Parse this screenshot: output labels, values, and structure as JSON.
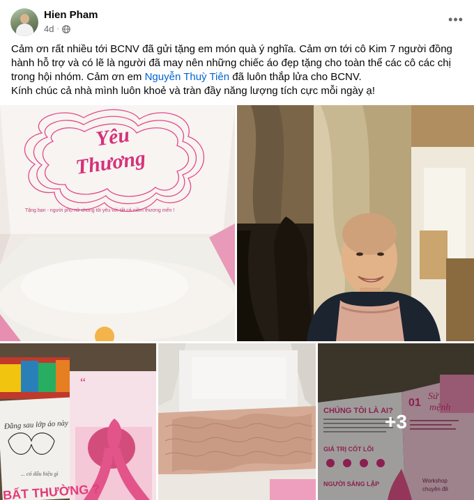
{
  "post": {
    "author": "Hien Pham",
    "time": "4d",
    "paragraphs": {
      "p1_before": "Cảm ơn rất nhiều tới BCNV đã gửi tặng em món quà ý nghĩa. Cảm ơn tới cô Kim 7 người đồng hành hỗ trợ và có lẽ là người đã may nên những chiếc áo đẹp tặng cho toàn thể các cô các chị trong hội nhóm. Cảm ơn em ",
      "mention": "Nguyễn Thuỳ Tiên",
      "p1_after": " đã luôn thắp lửa cho BCNV.",
      "p2": "Kính chúc cả nhà mình luôn khoẻ và tràn đầy năng lượng tích cực mỗi ngày ạ!"
    }
  },
  "photos": {
    "box_lettering": "Yêu Thương",
    "box_tagline": "Tặng bạn - người phụ nữ chúng tôi yêu với tất cả niềm thương mến !",
    "booklet_left_text": "Đằng sau lớp áo này",
    "booklet_left_sub": "... có dấu hiệu gì",
    "booklet_bottom_text": "BẤT THƯỜNG ?",
    "brochure_heading": "CHÚNG TÔI LÀ AI?",
    "brochure_values": "GIÁ TRỊ CỐT LÕI",
    "brochure_founder": "NGƯỜI SÁNG LẬP",
    "brochure_number": "01",
    "brochure_mission": "Sứ mệnh",
    "brochure_workshop": "Workshop chuyên đề",
    "more_count": "+3"
  },
  "icons": {
    "visibility": "globe-icon",
    "menu": "more-options-icon"
  },
  "colors": {
    "text": "#050505",
    "secondary": "#65676b",
    "mention": "#0064d1",
    "brand_pink": "#d6317a"
  }
}
